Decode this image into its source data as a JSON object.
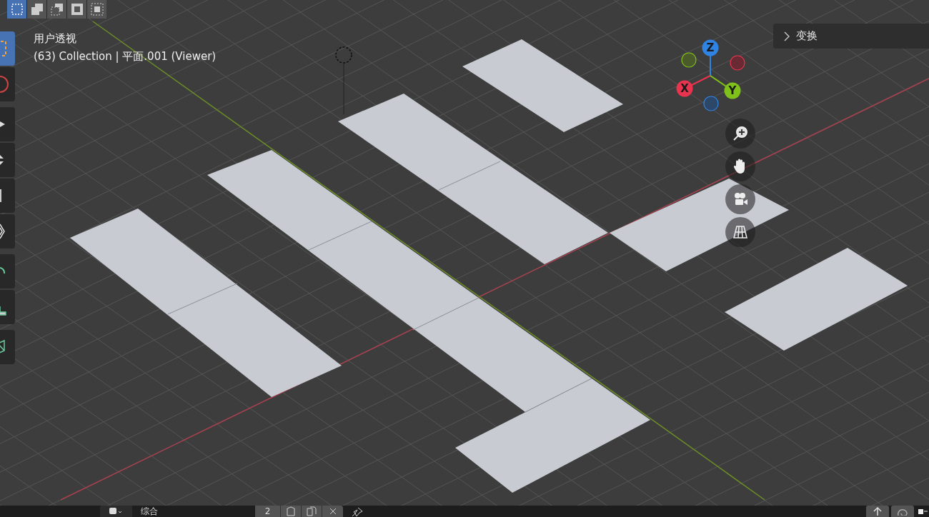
{
  "select_modes": [
    {
      "kind": "new",
      "selected": true
    },
    {
      "kind": "extend",
      "selected": false
    },
    {
      "kind": "subtract",
      "selected": false
    },
    {
      "kind": "invert",
      "selected": false
    },
    {
      "kind": "intersect",
      "selected": false
    }
  ],
  "tools": [
    {
      "kind": "select",
      "selected": true
    },
    {
      "kind": "cursor",
      "selected": false
    },
    {
      "kind": "move",
      "selected": false
    },
    {
      "kind": "rotate",
      "selected": false
    },
    {
      "kind": "scale",
      "selected": false
    },
    {
      "kind": "transform",
      "selected": false
    },
    {
      "kind": "annotate",
      "selected": false
    },
    {
      "kind": "measure",
      "selected": false
    },
    {
      "kind": "add",
      "selected": false
    }
  ],
  "viewport": {
    "view_name": "用户透视",
    "object_info": "(63) Collection | 平面.001 (Viewer)"
  },
  "sidebar_panel": {
    "title": "变换",
    "expanded": false
  },
  "gizmo": {
    "axes": [
      {
        "label": "Z",
        "color": "#2f83e3"
      },
      {
        "label": "X",
        "color": "#e8344f"
      },
      {
        "label": "Y",
        "color": "#7fc11a"
      }
    ]
  },
  "nav_buttons": [
    {
      "kind": "zoom"
    },
    {
      "kind": "pan"
    },
    {
      "kind": "camera"
    },
    {
      "kind": "ortho"
    }
  ],
  "bottom_bar": {
    "datablock": "综合",
    "users": "2"
  }
}
